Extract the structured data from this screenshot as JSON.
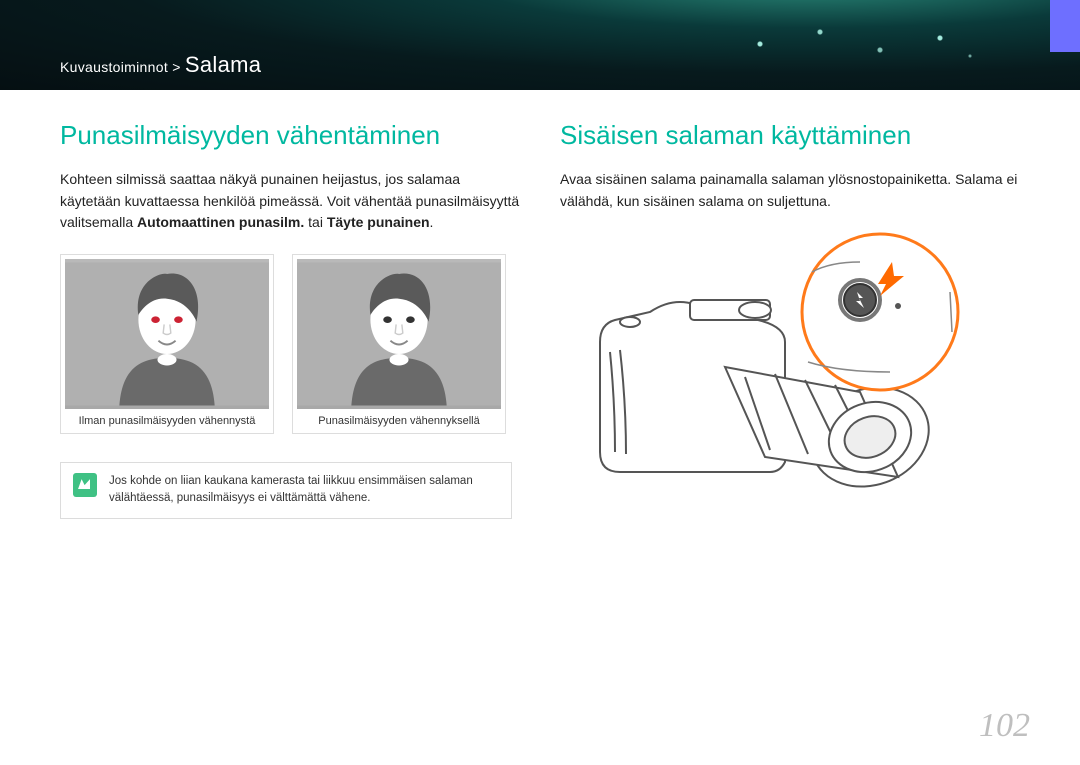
{
  "breadcrumb": {
    "category": "Kuvaustoiminnot",
    "sep": ">",
    "current": "Salama"
  },
  "left": {
    "heading": "Punasilmäisyyden vähentäminen",
    "p1": "Kohteen silmissä saattaa näkyä punainen heijastus, jos salamaa käytetään kuvattaessa henkilöä pimeässä. Voit vähentää punasilmäisyyttä valitsemalla ",
    "b1": "Automaattinen punasilm.",
    "mid": " tai ",
    "b2": "Täyte punainen",
    "tail": ".",
    "cap1": "Ilman punasilmäisyyden vähennystä",
    "cap2": "Punasilmäisyyden vähennyksellä",
    "note": "Jos kohde on liian kaukana kamerasta tai liikkuu ensimmäisen salaman välähtäessä, punasilmäisyys ei välttämättä vähene."
  },
  "right": {
    "heading": "Sisäisen salaman käyttäminen",
    "p1": "Avaa sisäinen salama painamalla salaman ylösnostopainiketta. Salama ei välähdä, kun sisäinen salama on suljettuna."
  },
  "page_number": "102"
}
